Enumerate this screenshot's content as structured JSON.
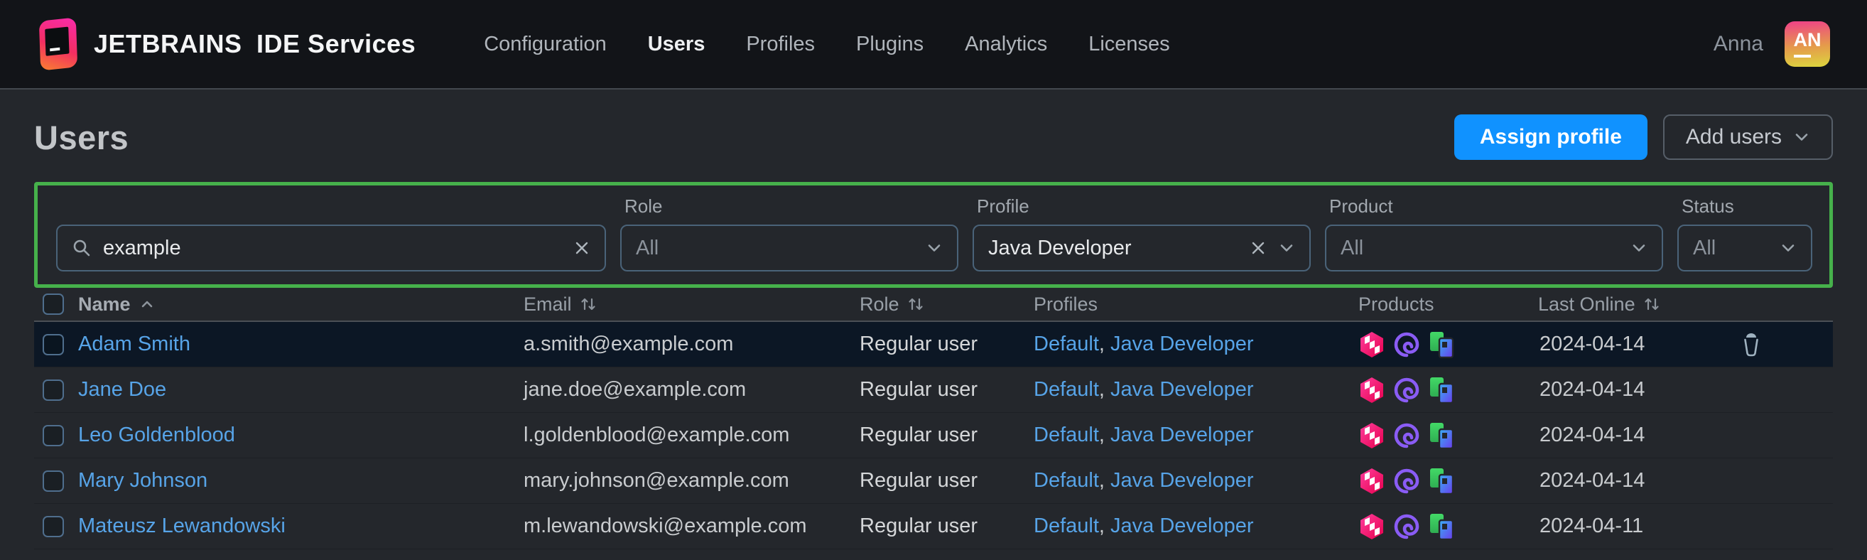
{
  "header": {
    "brand_bold": "JETBRAINS",
    "brand_regular": "IDE Services",
    "nav": [
      {
        "label": "Configuration",
        "active": false
      },
      {
        "label": "Users",
        "active": true
      },
      {
        "label": "Profiles",
        "active": false
      },
      {
        "label": "Plugins",
        "active": false
      },
      {
        "label": "Analytics",
        "active": false
      },
      {
        "label": "Licenses",
        "active": false
      }
    ],
    "user_name": "Anna",
    "avatar_initials": "AN"
  },
  "page": {
    "title": "Users",
    "assign_profile_button": "Assign profile",
    "add_users_button": "Add users"
  },
  "filters": {
    "highlight_border_color": "#46b14b",
    "search": {
      "value": "example"
    },
    "role": {
      "label": "Role",
      "value": "All"
    },
    "profile": {
      "label": "Profile",
      "value": "Java Developer"
    },
    "product": {
      "label": "Product",
      "value": "All"
    },
    "status": {
      "label": "Status",
      "value": "All"
    }
  },
  "table": {
    "columns": {
      "name": "Name",
      "email": "Email",
      "role": "Role",
      "profiles": "Profiles",
      "products": "Products",
      "last_online": "Last Online"
    },
    "sort": {
      "column": "Name",
      "direction": "ascending"
    },
    "profiles_separator": ", ",
    "product_icons": [
      "intellij-idea",
      "phpstorm",
      "pycharm"
    ],
    "rows": [
      {
        "name": "Adam Smith",
        "email": "a.smith@example.com",
        "role": "Regular user",
        "profiles": [
          "Default",
          "Java Developer"
        ],
        "last_online": "2024-04-14",
        "highlighted": true
      },
      {
        "name": "Jane Doe",
        "email": "jane.doe@example.com",
        "role": "Regular user",
        "profiles": [
          "Default",
          "Java Developer"
        ],
        "last_online": "2024-04-14",
        "highlighted": false
      },
      {
        "name": "Leo Goldenblood",
        "email": "l.goldenblood@example.com",
        "role": "Regular user",
        "profiles": [
          "Default",
          "Java Developer"
        ],
        "last_online": "2024-04-14",
        "highlighted": false
      },
      {
        "name": "Mary Johnson",
        "email": "mary.johnson@example.com",
        "role": "Regular user",
        "profiles": [
          "Default",
          "Java Developer"
        ],
        "last_online": "2024-04-14",
        "highlighted": false
      },
      {
        "name": "Mateusz Lewandowski",
        "email": "m.lewandowski@example.com",
        "role": "Regular user",
        "profiles": [
          "Default",
          "Java Developer"
        ],
        "last_online": "2024-04-11",
        "highlighted": false
      }
    ]
  },
  "colors": {
    "accent_blue": "#1092ff",
    "link_blue": "#57a4e8",
    "topbar_bg": "#121418",
    "page_bg": "#24272c",
    "highlighted_row_bg": "#0c1725"
  }
}
